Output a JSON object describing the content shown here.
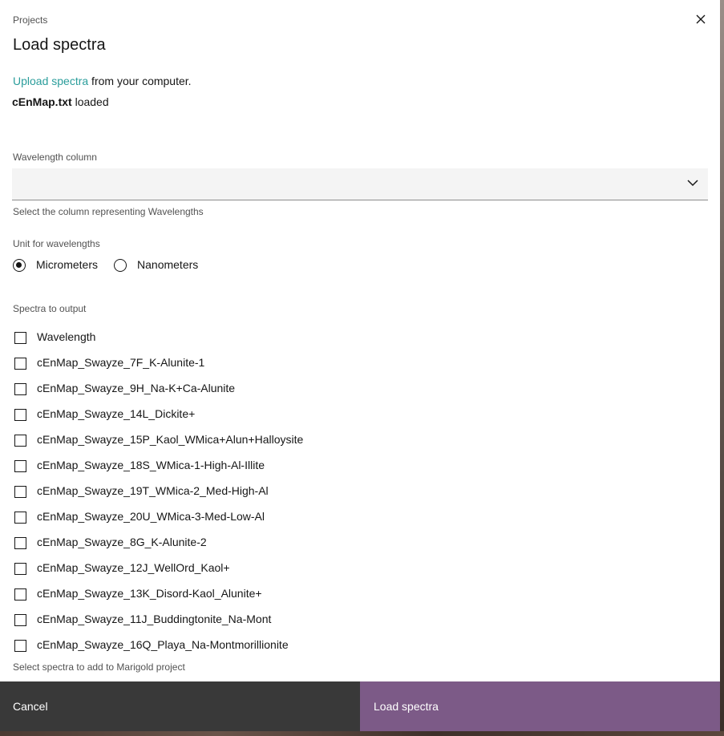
{
  "header": {
    "eyebrow": "Projects",
    "title": "Load spectra"
  },
  "upload": {
    "link_label": "Upload spectra",
    "suffix": " from your computer.",
    "file_name": "cEnMap.txt",
    "file_status": " loaded"
  },
  "wavelength_column": {
    "label": "Wavelength column",
    "value": "",
    "helper": "Select the column representing Wavelengths"
  },
  "unit": {
    "label": "Unit for wavelengths",
    "options": [
      {
        "label": "Micrometers",
        "selected": true
      },
      {
        "label": "Nanometers",
        "selected": false
      }
    ]
  },
  "spectra": {
    "label": "Spectra to output",
    "items": [
      {
        "label": "Wavelength",
        "checked": false
      },
      {
        "label": "cEnMap_Swayze_7F_K-Alunite-1",
        "checked": false
      },
      {
        "label": "cEnMap_Swayze_9H_Na-K+Ca-Alunite",
        "checked": false
      },
      {
        "label": "cEnMap_Swayze_14L_Dickite+",
        "checked": false
      },
      {
        "label": "cEnMap_Swayze_15P_Kaol_WMica+Alun+Halloysite",
        "checked": false
      },
      {
        "label": "cEnMap_Swayze_18S_WMica-1-High-Al-Illite",
        "checked": false
      },
      {
        "label": "cEnMap_Swayze_19T_WMica-2_Med-High-Al",
        "checked": false
      },
      {
        "label": "cEnMap_Swayze_20U_WMica-3-Med-Low-Al",
        "checked": false
      },
      {
        "label": "cEnMap_Swayze_8G_K-Alunite-2",
        "checked": false
      },
      {
        "label": "cEnMap_Swayze_12J_WellOrd_Kaol+",
        "checked": false
      },
      {
        "label": "cEnMap_Swayze_13K_Disord-Kaol_Alunite+",
        "checked": false
      },
      {
        "label": "cEnMap_Swayze_11J_Buddingtonite_Na-Mont",
        "checked": false
      },
      {
        "label": "cEnMap_Swayze_16Q_Playa_Na-Montmorillionite",
        "checked": false
      }
    ],
    "helper": "Select spectra to add to Marigold project"
  },
  "footer": {
    "cancel_label": "Cancel",
    "primary_label": "Load spectra"
  },
  "colors": {
    "link": "#2a9d9b",
    "primary_button": "#7c5a87",
    "secondary_button": "#393939"
  },
  "icons": {
    "close": "close-icon",
    "dropdown": "chevron-down-icon"
  }
}
